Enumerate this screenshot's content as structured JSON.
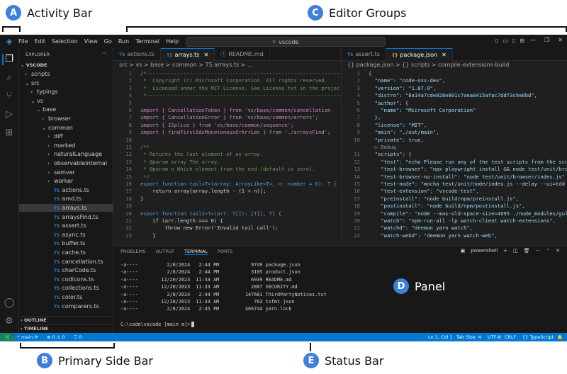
{
  "callouts": {
    "activity_bar": {
      "badge": "A",
      "label": "Activity Bar"
    },
    "primary_side_bar": {
      "badge": "B",
      "label": "Primary Side Bar"
    },
    "editor_groups": {
      "badge": "C",
      "label": "Editor Groups"
    },
    "panel": {
      "badge": "D",
      "label": "Panel"
    },
    "status_bar": {
      "badge": "E",
      "label": "Status Bar"
    }
  },
  "titlebar": {
    "menu": [
      "File",
      "Edit",
      "Selection",
      "View",
      "Go",
      "Run",
      "Terminal",
      "Help"
    ],
    "search_text": "vscode"
  },
  "sidebar": {
    "title": "EXPLORER",
    "root": "VSCODE",
    "tree": [
      {
        "label": "scripts",
        "depth": 1,
        "type": "folder"
      },
      {
        "label": "src",
        "depth": 1,
        "type": "folder-open"
      },
      {
        "label": "typings",
        "depth": 2,
        "type": "folder"
      },
      {
        "label": "vs",
        "depth": 2,
        "type": "folder-open"
      },
      {
        "label": "base",
        "depth": 3,
        "type": "folder-open"
      },
      {
        "label": "browser",
        "depth": 4,
        "type": "folder"
      },
      {
        "label": "common",
        "depth": 4,
        "type": "folder-open"
      },
      {
        "label": "diff",
        "depth": 5,
        "type": "folder"
      },
      {
        "label": "marked",
        "depth": 5,
        "type": "folder"
      },
      {
        "label": "naturalLanguage",
        "depth": 5,
        "type": "folder"
      },
      {
        "label": "observableInternal",
        "depth": 5,
        "type": "folder"
      },
      {
        "label": "semver",
        "depth": 5,
        "type": "folder"
      },
      {
        "label": "worker",
        "depth": 5,
        "type": "folder"
      },
      {
        "label": "actions.ts",
        "depth": 5,
        "type": "ts"
      },
      {
        "label": "amd.ts",
        "depth": 5,
        "type": "ts"
      },
      {
        "label": "arrays.ts",
        "depth": 5,
        "type": "ts",
        "selected": true
      },
      {
        "label": "arraysFind.ts",
        "depth": 5,
        "type": "ts"
      },
      {
        "label": "assert.ts",
        "depth": 5,
        "type": "ts"
      },
      {
        "label": "async.ts",
        "depth": 5,
        "type": "ts"
      },
      {
        "label": "buffer.ts",
        "depth": 5,
        "type": "ts"
      },
      {
        "label": "cache.ts",
        "depth": 5,
        "type": "ts"
      },
      {
        "label": "cancellation.ts",
        "depth": 5,
        "type": "ts"
      },
      {
        "label": "charCode.ts",
        "depth": 5,
        "type": "ts"
      },
      {
        "label": "codicons.ts",
        "depth": 5,
        "type": "ts"
      },
      {
        "label": "collections.ts",
        "depth": 5,
        "type": "ts"
      },
      {
        "label": "color.ts",
        "depth": 5,
        "type": "ts"
      },
      {
        "label": "comparers.ts",
        "depth": 5,
        "type": "ts"
      }
    ],
    "outline_label": "OUTLINE",
    "timeline_label": "TIMELINE"
  },
  "editor1": {
    "tabs": [
      {
        "icon": "TS",
        "label": "actions.ts",
        "active": false
      },
      {
        "icon": "TS",
        "label": "arrays.ts",
        "active": true
      },
      {
        "icon": "",
        "label": "README.md",
        "active": false
      }
    ],
    "breadcrumb": "src > vs > base > common > TS arrays.ts > ...",
    "lines": [
      {
        "n": "1",
        "t": "/*---------------------------------------------------------------------------",
        "c": "cmt"
      },
      {
        "n": "2",
        "t": " *  Copyright (c) Microsoft Corporation. All rights reserved.",
        "c": "cmt"
      },
      {
        "n": "3",
        "t": " *  Licensed under the MIT License. See License.txt in the projec",
        "c": "cmt"
      },
      {
        "n": "4",
        "t": " *--------------------------------------------------------------------------",
        "c": "cmt"
      },
      {
        "n": "5",
        "t": "",
        "c": ""
      },
      {
        "n": "6",
        "t": "import { CancellationToken } from 'vs/base/common/cancellation",
        "c": "imp"
      },
      {
        "n": "7",
        "t": "import { CancellationError } from 'vs/base/common/errors';",
        "c": "imp"
      },
      {
        "n": "8",
        "t": "import { ISplice } from 'vs/base/common/sequence';",
        "c": "imp"
      },
      {
        "n": "9",
        "t": "import { findFirstIdxMonotonousOrArrLen } from './arraysFind';",
        "c": "imp"
      },
      {
        "n": "10",
        "t": "",
        "c": ""
      },
      {
        "n": "11",
        "t": "/**",
        "c": "cmt"
      },
      {
        "n": "12",
        "t": " * Returns the last element of an array.",
        "c": "cmt"
      },
      {
        "n": "13",
        "t": " * @param array The array.",
        "c": "cmt"
      },
      {
        "n": "14",
        "t": " * @param n Which element from the end (default is zero).",
        "c": "cmt"
      },
      {
        "n": "15",
        "t": " */",
        "c": "cmt"
      },
      {
        "n": "16",
        "t": "export function tail<T>(array: ArrayLike<T>, n: number = 0): T {",
        "c": "fn"
      },
      {
        "n": "17",
        "t": "    return array[array.length - (1 + n)];",
        "c": "plain"
      },
      {
        "n": "18",
        "t": "}",
        "c": "plain"
      },
      {
        "n": "19",
        "t": "",
        "c": ""
      },
      {
        "n": "20",
        "t": "export function tail2<T>(arr: T[]): [T[], T] {",
        "c": "fn"
      },
      {
        "n": "21",
        "t": "    if (arr.length === 0) {",
        "c": "plain"
      },
      {
        "n": "22",
        "t": "        throw new Error('Invalid tail call');",
        "c": "plain"
      },
      {
        "n": "23",
        "t": "    }",
        "c": "plain"
      }
    ]
  },
  "editor2": {
    "tabs": [
      {
        "icon": "TS",
        "label": "assert.ts",
        "active": false
      },
      {
        "icon": "{}",
        "label": "package.json",
        "active": true
      }
    ],
    "breadcrumb": "{} package.json > {} scripts > compile-extensions-build",
    "lines": [
      {
        "n": "1",
        "t": "{"
      },
      {
        "n": "2",
        "t": "  \"name\": \"code-oss-dev\","
      },
      {
        "n": "3",
        "t": "  \"version\": \"1.87.0\","
      },
      {
        "n": "4",
        "t": "  \"distro\": \"8a14a7cde028e801c7aea8415afac7ddf3c9a0bd\","
      },
      {
        "n": "5",
        "t": "  \"author\": {"
      },
      {
        "n": "6",
        "t": "    \"name\": \"Microsoft Corporation\""
      },
      {
        "n": "7",
        "t": "  },"
      },
      {
        "n": "8",
        "t": "  \"license\": \"MIT\","
      },
      {
        "n": "9",
        "t": "  \"main\": \"./out/main\","
      },
      {
        "n": "10",
        "t": "  \"private\": true,"
      },
      {
        "n": "",
        "t": "  ▷ Debug"
      },
      {
        "n": "11",
        "t": "  \"scripts\": {"
      },
      {
        "n": "12",
        "t": "    \"test\": \"echo Please run any of the test scripts from the scr"
      },
      {
        "n": "13",
        "t": "    \"test-browser\": \"npx playwright install && node test/unit/bro"
      },
      {
        "n": "14",
        "t": "    \"test-browser-no-install\": \"node test/unit/browser/index.js\""
      },
      {
        "n": "15",
        "t": "    \"test-node\": \"mocha test/unit/node/index.js --delay --ui=tdd"
      },
      {
        "n": "16",
        "t": "    \"test-extension\": \"vscode-test\","
      },
      {
        "n": "17",
        "t": "    \"preinstall\": \"node build/npm/preinstall.js\","
      },
      {
        "n": "18",
        "t": "    \"postinstall\": \"node build/npm/postinstall.js\","
      },
      {
        "n": "19",
        "t": "    \"compile\": \"node --max-old-space-size=4095 ./node_modules/gul"
      },
      {
        "n": "20",
        "t": "    \"watch\": \"npm-run-all -lp watch-client watch-extensions\","
      },
      {
        "n": "21",
        "t": "    \"watchd\": \"deemon yarn watch\","
      },
      {
        "n": "22",
        "t": "    \"watch-webd\": \"deemon yarn watch-web\","
      }
    ]
  },
  "panel": {
    "tabs": [
      "PROBLEMS",
      "OUTPUT",
      "TERMINAL",
      "PORTS"
    ],
    "active_tab": "TERMINAL",
    "shell_label": "powershell",
    "terminal_lines": [
      "-a----          2/8/2024   2:44 PM           9749 package.json",
      "-a----          2/8/2024   2:44 PM           3185 product.json",
      "-a----        12/20/2023  11:33 AM           6939 README.md",
      "-a----        12/20/2023  11:33 AM           2807 SECURITY.md",
      "-a----          2/8/2024   2:44 PM         147681 ThirdPartyNotices.txt",
      "-a----        12/20/2023  11:33 AM            763 tsfmt.json",
      "-a----          2/8/2024   2:45 PM         466744 yarn.lock"
    ],
    "prompt": "C:\\code\\vscode [main ≡]>"
  },
  "statusbar": {
    "branch": "main",
    "problems": "⊗ 0 ⚠ 0",
    "ports": "⛉ 0",
    "position": "Ln 1, Col 1",
    "tab_size": "Tab Size: 4",
    "encoding": "UTF-8",
    "eol": "CRLF",
    "language": "{} TypeScript"
  },
  "colors": {
    "accent": "#0078d4",
    "callout": "#3e7fd9",
    "background": "#1f1f1f"
  }
}
